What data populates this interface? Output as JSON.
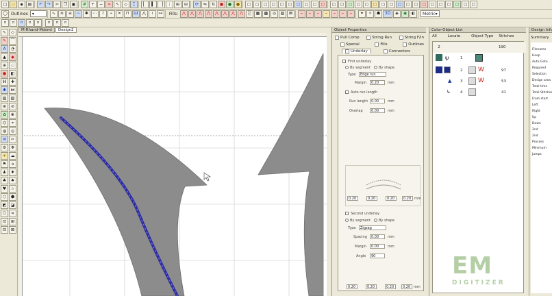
{
  "toolbar1": {
    "outlines_label": "Outlines"
  },
  "toolbar2": {
    "fills_label": "Fills:",
    "metric_label": "Metric",
    "view_3d_label": "3D"
  },
  "doc_tabs": [
    "M-Rhand-Mdsmt",
    "Design2"
  ],
  "object_properties": {
    "title": "Object Properties",
    "tabs_row1": [
      "Pull Comp",
      "String Run",
      "String F/In"
    ],
    "tabs_row2": [
      "Special",
      "Fills",
      "Outlines"
    ],
    "tabs_row3": [
      "Underlay",
      "Connectors"
    ],
    "first_underlay": {
      "label": "First underlay",
      "by_segment": "By segment",
      "by_shape": "By shape",
      "type_label": "Type",
      "type_value": "Edge run",
      "margin_label": "Margin",
      "margin_value": "0.20",
      "margin_unit": "mm",
      "auto_run_label": "Auto run length",
      "run_length_label": "Run length",
      "run_length_value": "0.00",
      "overlap_label": "Overlap",
      "overlap_value": "0.00",
      "unit": "mm",
      "sliders": [
        "0.20",
        "0.20",
        "0.20",
        "0.20"
      ],
      "sliders_unit": "mm"
    },
    "second_underlay": {
      "label": "Second underlay",
      "by_segment": "By segment",
      "by_shape": "By shape",
      "type_label": "Type",
      "type_value": "Zigzag",
      "spacing_label": "Spacing",
      "spacing_value": "0.00",
      "margin_label": "Margin",
      "margin_value": "0.00",
      "angle_label": "Angle",
      "angle_value": "90",
      "unit": "mm",
      "sliders": [
        "0.20",
        "0.20",
        "0.20",
        "0.20"
      ],
      "sliders_unit": "mm"
    }
  },
  "color_object_list": {
    "title": "Color-Object List",
    "columns": [
      "All",
      "Locate",
      "Object Type",
      "Stitches"
    ],
    "rows": [
      {
        "num": "2",
        "type": "",
        "stitches": "190"
      },
      {
        "num": "1",
        "type": "",
        "stitches": ""
      },
      {
        "num": "2",
        "type": "",
        "stitches": "97"
      },
      {
        "num": "3",
        "type": "",
        "stitches": "53"
      },
      {
        "num": "4",
        "type": "",
        "stitches": "41"
      }
    ]
  },
  "design_info": {
    "title": "Design Information",
    "tab": "Summary",
    "labels": [
      "Filename",
      "Hoop",
      "Auto Goto",
      "Required",
      "Selection",
      "Design area",
      "Total time",
      "Total Stitches",
      "From start",
      "Left",
      "Right",
      "Up",
      "Down",
      "2nd",
      "2nd",
      "Process",
      "Minimum",
      "Jumps"
    ]
  },
  "watermark": {
    "line1": "EM",
    "line2": "DIGITIZER"
  },
  "colors": {
    "shape_fill": "#8c8c8c",
    "stitch_line": "#2a2a9e",
    "panel_bg": "#ece9d8",
    "selected_row": "#1a2c86"
  }
}
